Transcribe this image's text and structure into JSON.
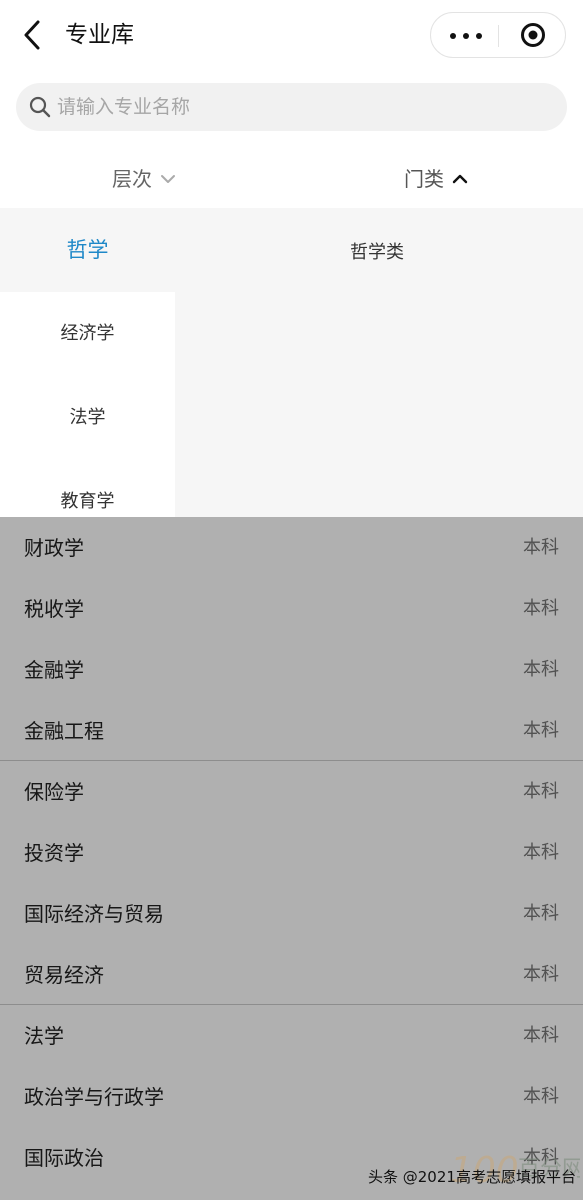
{
  "header": {
    "title": "专业库",
    "back_icon": "back-chevron-icon",
    "more_icon": "more-dots-icon",
    "capsule_icon": "target-circle-icon"
  },
  "search": {
    "placeholder": "请输入专业名称",
    "icon": "search-icon"
  },
  "filters": [
    {
      "label": "层次",
      "state": "collapsed"
    },
    {
      "label": "门类",
      "state": "expanded"
    }
  ],
  "left_categories": [
    {
      "label": "哲学",
      "active": true
    },
    {
      "label": "经济学",
      "active": false
    },
    {
      "label": "法学",
      "active": false
    },
    {
      "label": "教育学",
      "active": false
    }
  ],
  "subcategories": [
    {
      "label": "哲学类"
    }
  ],
  "majors": [
    {
      "name": "财政学",
      "level": "本科"
    },
    {
      "name": "税收学",
      "level": "本科"
    },
    {
      "name": "金融学",
      "level": "本科"
    },
    {
      "name": "金融工程",
      "level": "本科"
    },
    {
      "name": "保险学",
      "level": "本科"
    },
    {
      "name": "投资学",
      "level": "本科"
    },
    {
      "name": "国际经济与贸易",
      "level": "本科"
    },
    {
      "name": "贸易经济",
      "level": "本科"
    },
    {
      "name": "法学",
      "level": "本科"
    },
    {
      "name": "政治学与行政学",
      "level": "本科"
    },
    {
      "name": "国际政治",
      "level": "本科"
    }
  ],
  "watermark": {
    "text": "头条 @2021高考志愿填报平台",
    "logo_text": "100百分网"
  },
  "colors": {
    "accent": "#1e88c8",
    "overlay": "rgba(0,0,0,0.31)"
  }
}
